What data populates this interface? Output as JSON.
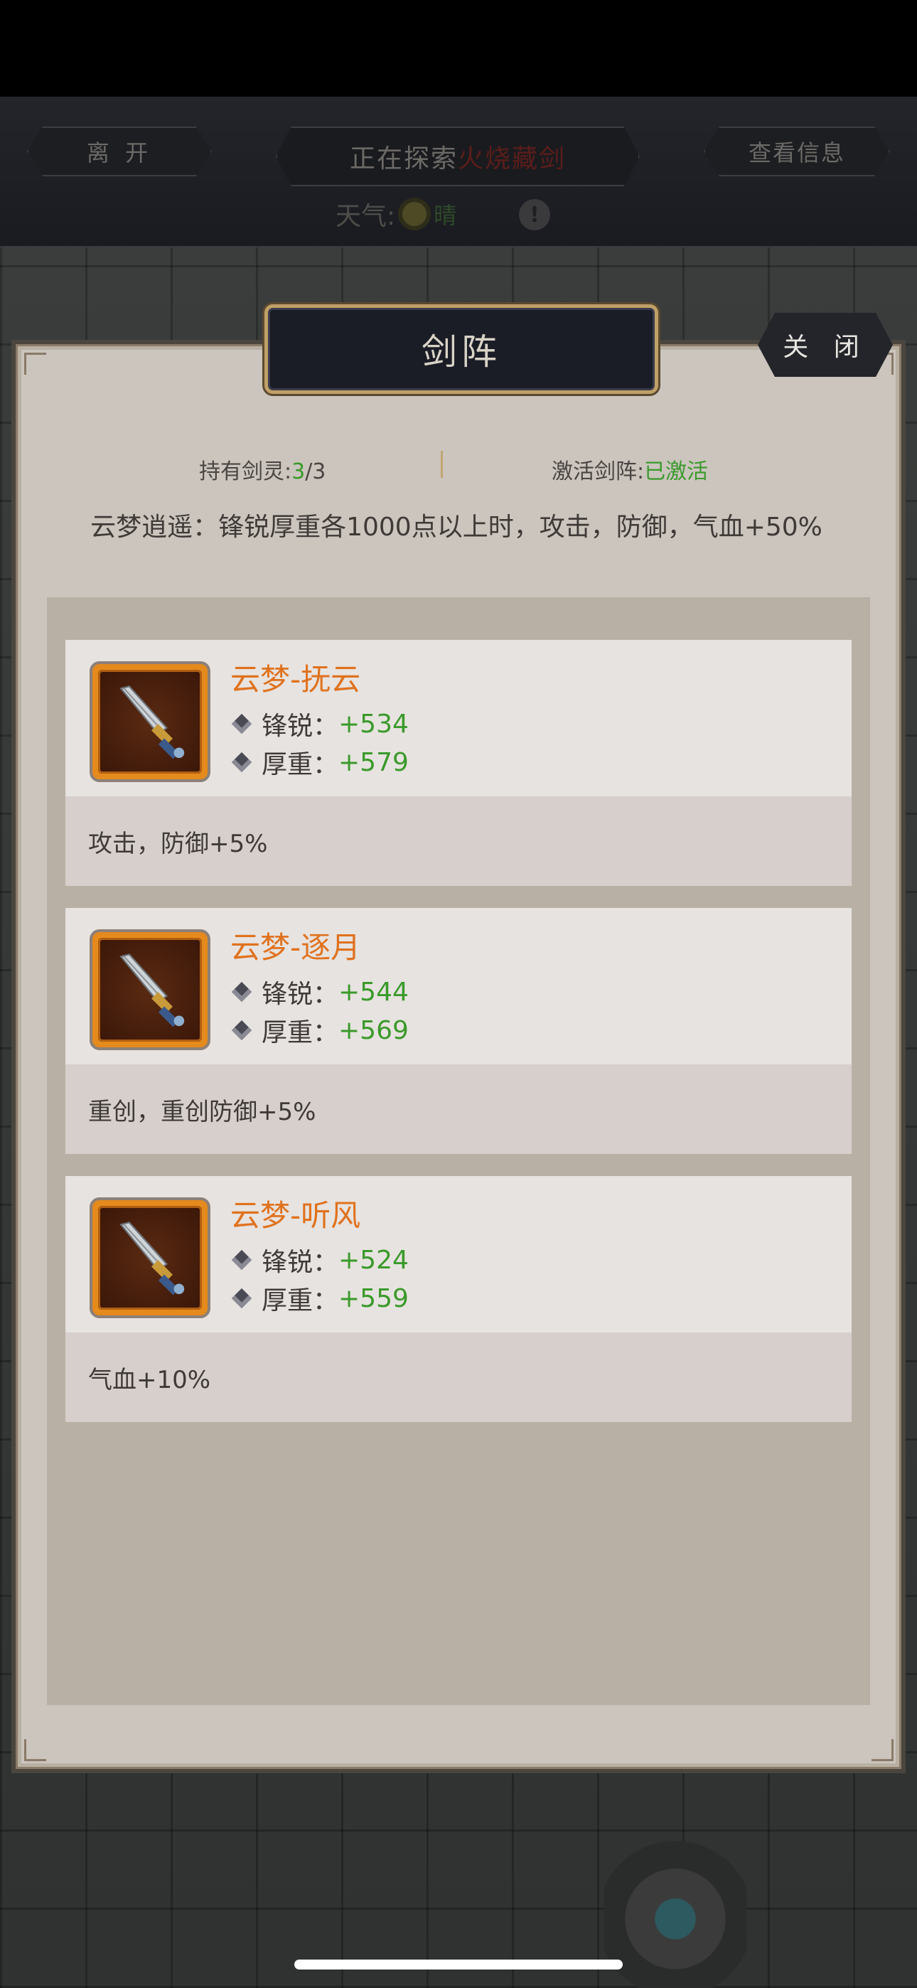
{
  "top_bar": {
    "leave_label": "离 开",
    "explore_prefix": "正在探索",
    "explore_name": "火烧藏剑",
    "info_label": "查看信息",
    "weather_label": "天气:",
    "weather_value": "晴"
  },
  "panel": {
    "title": "剑阵",
    "close_label": "关 闭",
    "holding_label": "持有剑灵:",
    "holding_current": "3",
    "holding_total": "/3",
    "active_label": "激活剑阵:",
    "active_value": "已激活",
    "description": "云梦逍遥：锋锐厚重各1000点以上时，攻击，防御，气血+50%"
  },
  "cards": [
    {
      "name": "云梦-抚云",
      "attr1_label": "锋锐：",
      "attr1_value": "+534",
      "attr2_label": "厚重：",
      "attr2_value": "+579",
      "bonus": "攻击，防御+5%"
    },
    {
      "name": "云梦-逐月",
      "attr1_label": "锋锐：",
      "attr1_value": "+544",
      "attr2_label": "厚重：",
      "attr2_value": "+569",
      "bonus": "重创，重创防御+5%"
    },
    {
      "name": "云梦-听风",
      "attr1_label": "锋锐：",
      "attr1_value": "+524",
      "attr2_label": "厚重：",
      "attr2_value": "+559",
      "bonus": "气血+10%"
    }
  ],
  "colors": {
    "accent_orange": "#e0721e",
    "value_green": "#3a9a2a",
    "panel_bg": "#cbc5be"
  }
}
